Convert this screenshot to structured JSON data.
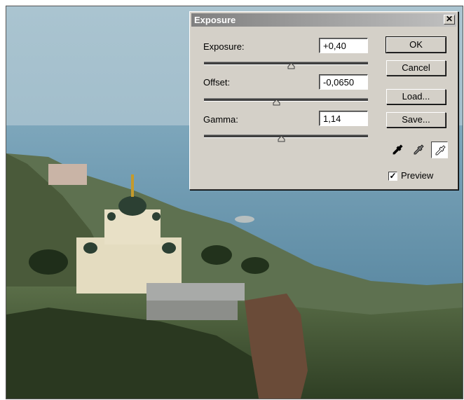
{
  "dialog": {
    "title": "Exposure",
    "close_glyph": "✕",
    "close_icon": "close-icon"
  },
  "fields": {
    "exposure": {
      "label": "Exposure:",
      "value": "+0,40",
      "slider_fraction": 0.53
    },
    "offset": {
      "label": "Offset:",
      "value": "-0,0650",
      "slider_fraction": 0.44
    },
    "gamma": {
      "label": "Gamma:",
      "value": "1,14",
      "slider_fraction": 0.47
    }
  },
  "buttons": {
    "ok": "OK",
    "cancel": "Cancel",
    "load": "Load...",
    "save": "Save..."
  },
  "eyedroppers": [
    {
      "name": "black-point-eyedropper-icon",
      "color": "#000000",
      "active": false
    },
    {
      "name": "gray-point-eyedropper-icon",
      "color": "#808080",
      "active": false
    },
    {
      "name": "white-point-eyedropper-icon",
      "color": "#ffffff",
      "active": true
    }
  ],
  "preview": {
    "label": "Preview",
    "checked": true,
    "check_glyph": "✓"
  },
  "colors": {
    "dialog_bg": "#d4d0c8",
    "title_gradient_start": "#808080",
    "sky": "#a9c3cf",
    "sea": "#6f9cb3",
    "hills": "#3d5230"
  }
}
